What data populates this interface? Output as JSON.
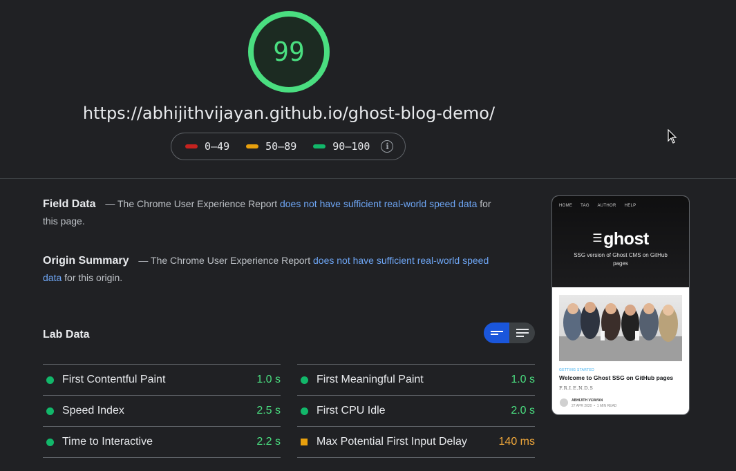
{
  "report": {
    "score": "99",
    "url": "https://abhijithvijayan.github.io/ghost-blog-demo/",
    "score_color": "#4ade80"
  },
  "legend": {
    "items": [
      {
        "label": "0–49",
        "color": "#c5221f"
      },
      {
        "label": "50–89",
        "color": "#e8a00d"
      },
      {
        "label": "90–100",
        "color": "#12b76a"
      }
    ],
    "info_icon": "info-icon"
  },
  "field_data": {
    "heading": "Field Data",
    "prefix": "— The Chrome User Experience Report",
    "link": "does not have sufficient real-world speed data",
    "suffix": "for this page."
  },
  "origin_summary": {
    "heading": "Origin Summary",
    "prefix": "— The Chrome User Experience Report",
    "link": "does not have sufficient real-world speed data",
    "suffix": "for this origin."
  },
  "lab_data": {
    "title": "Lab Data",
    "toggle": {
      "compact_icon": "compact-view-icon",
      "expanded_icon": "expanded-view-icon"
    },
    "left": [
      {
        "name": "First Contentful Paint",
        "value": "1.0 s",
        "status": "pass"
      },
      {
        "name": "Speed Index",
        "value": "2.5 s",
        "status": "pass"
      },
      {
        "name": "Time to Interactive",
        "value": "2.2 s",
        "status": "pass"
      }
    ],
    "right": [
      {
        "name": "First Meaningful Paint",
        "value": "1.0 s",
        "status": "pass"
      },
      {
        "name": "First CPU Idle",
        "value": "2.0 s",
        "status": "pass"
      },
      {
        "name": "Max Potential First Input Delay",
        "value": "140 ms",
        "status": "average"
      }
    ],
    "colors": {
      "pass": "#4ade80",
      "pass_dot": "#12b76a",
      "average": "#f2a93b",
      "average_sq": "#e8a00d"
    }
  },
  "screenshot": {
    "nav": [
      "HOME",
      "TAG",
      "AUTHOR",
      "HELP"
    ],
    "logo": "ghost",
    "description": "SSG version of Ghost CMS on GitHub pages",
    "tag": "GETTING STARTED",
    "post_title": "Welcome to Ghost SSG on GitHub pages",
    "excerpt": "F.R.I.E.N.D.S",
    "author": "ABHIJITH VIJAYAN",
    "date": "27 APR 2020",
    "separator": "•",
    "read_time": "1 MIN READ"
  }
}
